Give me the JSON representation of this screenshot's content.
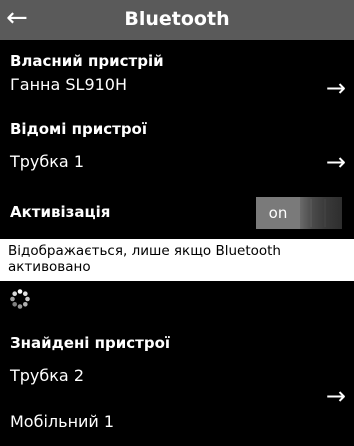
{
  "header": {
    "back_icon": "back-arrow-icon",
    "title": "Bluetooth"
  },
  "own_device": {
    "label": "Власний пристрій",
    "value": "Ганна SL910H"
  },
  "known_devices": {
    "label": "Відомі пристрої",
    "items": [
      {
        "value": "Трубка 1"
      }
    ]
  },
  "activation": {
    "label": "Активізація",
    "toggle_text": "on",
    "enabled": true
  },
  "note": {
    "text": "Відображається, лише якщо Bluetooth активовано"
  },
  "search": {
    "icon": "loading-spinner-icon"
  },
  "found_devices": {
    "label": "Знайдені пристрої",
    "items": [
      {
        "value": "Трубка 2"
      },
      {
        "value": "Мобільний 1"
      }
    ]
  },
  "colors": {
    "background": "#000000",
    "header": "#5a5a5a",
    "toggle_on": "#7a7a7a",
    "note_background": "#ffffff"
  }
}
